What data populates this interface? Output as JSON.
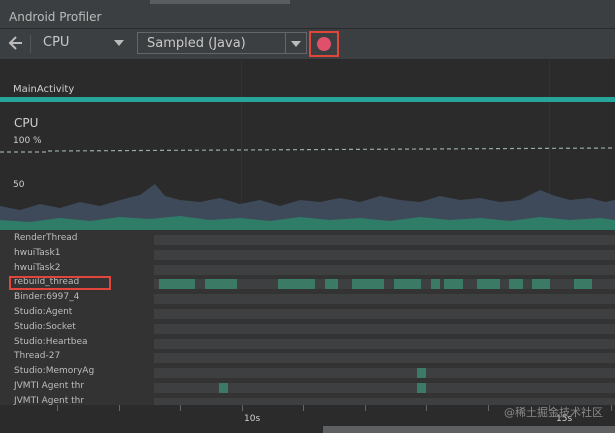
{
  "window": {
    "title": "Android Profiler"
  },
  "toolbar": {
    "process": "CPU",
    "profiling_mode": "Sampled (Java)"
  },
  "activity": {
    "name": "MainActivity"
  },
  "cpu": {
    "title": "CPU",
    "y_max_label": "100 %",
    "y_mid_label": "50"
  },
  "threads": [
    {
      "name": "RenderThread",
      "blocks": []
    },
    {
      "name": "hwuiTask1",
      "blocks": []
    },
    {
      "name": "hwuiTask2",
      "blocks": []
    },
    {
      "name": "rebuild_thread",
      "blocks": [
        [
          0.01,
          0.09
        ],
        [
          0.11,
          0.18
        ],
        [
          0.27,
          0.35
        ],
        [
          0.37,
          0.4
        ],
        [
          0.43,
          0.5
        ],
        [
          0.52,
          0.58
        ],
        [
          0.6,
          0.62
        ],
        [
          0.63,
          0.67
        ],
        [
          0.7,
          0.75
        ],
        [
          0.77,
          0.8
        ],
        [
          0.82,
          0.86
        ],
        [
          0.91,
          0.95
        ]
      ]
    },
    {
      "name": "Binder:6997_4",
      "blocks": []
    },
    {
      "name": "Studio:Agent",
      "blocks": []
    },
    {
      "name": "Studio:Socket",
      "blocks": []
    },
    {
      "name": "Studio:Heartbea",
      "blocks": []
    },
    {
      "name": "Thread-27",
      "blocks": []
    },
    {
      "name": "Studio:MemoryAg",
      "blocks": [
        [
          0.57,
          0.59
        ]
      ]
    },
    {
      "name": "JVMTI Agent thr",
      "blocks": [
        [
          0.14,
          0.16
        ],
        [
          0.57,
          0.59
        ]
      ]
    },
    {
      "name": "JVMTI Agent thr",
      "blocks": []
    }
  ],
  "timeline": {
    "tick_labels": [
      "10s",
      "15s"
    ]
  },
  "watermark": "@稀土掘金技术社区"
}
